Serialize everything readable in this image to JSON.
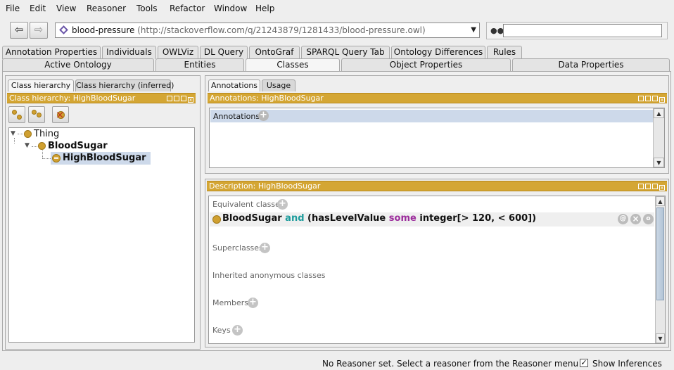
{
  "menu": [
    "File",
    "Edit",
    "View",
    "Reasoner",
    "Tools",
    "Refactor",
    "Window",
    "Help"
  ],
  "address": {
    "back_icon": "back-arrow-icon",
    "forward_icon": "forward-arrow-icon",
    "ontology_name": "blood-pressure",
    "ontology_iri": "(http://stackoverflow.com/q/21243879/1281433/blood-pressure.owl)",
    "search_value": ""
  },
  "tabs_row1": [
    "Annotation Properties",
    "Individuals",
    "OWLViz",
    "DL Query",
    "OntoGraf",
    "SPARQL Query Tab",
    "Ontology Differences",
    "Rules"
  ],
  "tabs_row2": [
    "Active Ontology",
    "Entities",
    "Classes",
    "Object Properties",
    "Data Properties"
  ],
  "active_tab": "Classes",
  "left": {
    "subtabs": [
      "Class hierarchy",
      "Class hierarchy (inferred)"
    ],
    "header": "Class hierarchy: HighBloodSugar",
    "tree": {
      "root": "Thing",
      "child": "BloodSugar",
      "grandchild": "HighBloodSugar"
    }
  },
  "right": {
    "subtabs": [
      "Annotations",
      "Usage"
    ],
    "annotations_header": "Annotations: HighBloodSugar",
    "annotations_row": "Annotations",
    "description_header": "Description: HighBloodSugar",
    "sections": {
      "equivalent": "Equivalent classes",
      "superclasses": "Superclasses",
      "inherited": "Inherited anonymous classes",
      "members": "Members",
      "keys": "Keys"
    },
    "expression": {
      "cls": "BloodSugar",
      "and": "and",
      "open": "(hasLevelValue",
      "some": "some",
      "rest": "integer[> 120, < 600])"
    },
    "row_buttons": [
      "@",
      "×",
      "o"
    ]
  },
  "status": {
    "message": "No Reasoner set. Select a reasoner from the Reasoner menu",
    "show_inferences": "Show Inferences",
    "show_inferences_checked": true,
    "check_glyph": "✓"
  },
  "colors": {
    "view_header": "#d4a634",
    "class_circle": "#d0a030",
    "selection": "#cdd9ea",
    "kw_and": "#1c9c9c",
    "kw_some": "#9c2c9c"
  }
}
